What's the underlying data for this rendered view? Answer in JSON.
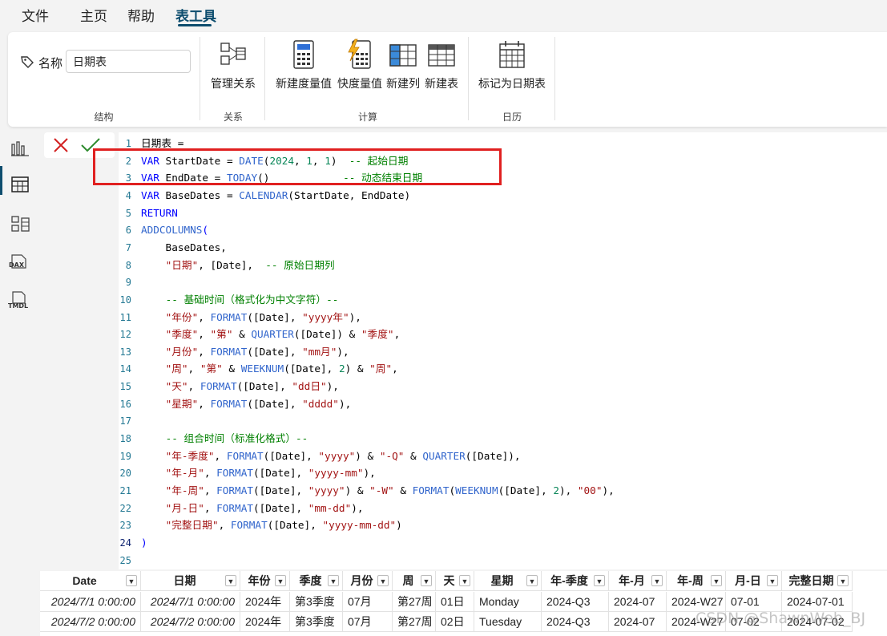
{
  "menu": {
    "tabs": [
      "文件",
      "主页",
      "帮助",
      "表工具"
    ],
    "active": "表工具"
  },
  "ribbon": {
    "name_label": "名称",
    "name_value": "日期表",
    "groups": {
      "structure": "结构",
      "relations": "关系",
      "calc": "计算",
      "calendar": "日历"
    },
    "buttons": {
      "manage_relations": "管理关系",
      "new_measure": "新建度量值",
      "quick_measure": "快度量值",
      "new_column": "新建列",
      "new_table": "新建表",
      "mark_date_table": "标记为日期表"
    }
  },
  "rail_icons": [
    "report-view-icon",
    "table-view-icon",
    "model-view-icon",
    "dax-query-icon",
    "tmdl-view-icon"
  ],
  "rail_labels": {
    "dax": "DAX",
    "tmdl": "TMDL"
  },
  "editor": {
    "lines": [
      [
        [
          "idx",
          "日期表 ="
        ]
      ],
      [
        [
          "kw",
          "VAR"
        ],
        [
          "idx",
          " StartDate = "
        ],
        [
          "fn",
          "DATE"
        ],
        [
          "idx",
          "("
        ],
        [
          "num",
          "2024"
        ],
        [
          "idx",
          ", "
        ],
        [
          "num",
          "1"
        ],
        [
          "idx",
          ", "
        ],
        [
          "num",
          "1"
        ],
        [
          "idx",
          ")  "
        ],
        [
          "cm",
          "-- 起始日期"
        ]
      ],
      [
        [
          "kw",
          "VAR"
        ],
        [
          "idx",
          " EndDate = "
        ],
        [
          "fn",
          "TODAY"
        ],
        [
          "idx",
          "()            "
        ],
        [
          "cm",
          "-- 动态结束日期"
        ]
      ],
      [
        [
          "kw",
          "VAR"
        ],
        [
          "idx",
          " BaseDates = "
        ],
        [
          "fn",
          "CALENDAR"
        ],
        [
          "idx",
          "(StartDate, EndDate)"
        ]
      ],
      [
        [
          "kw",
          "RETURN"
        ]
      ],
      [
        [
          "fn",
          "ADDCOLUMNS"
        ],
        [
          "kw",
          "("
        ]
      ],
      [
        [
          "idx",
          "    BaseDates,"
        ]
      ],
      [
        [
          "idx",
          "    "
        ],
        [
          "str",
          "\"日期\""
        ],
        [
          "idx",
          ", [Date],  "
        ],
        [
          "cm",
          "-- 原始日期列"
        ]
      ],
      [
        [
          "idx",
          ""
        ]
      ],
      [
        [
          "idx",
          "    "
        ],
        [
          "cm",
          "-- 基础时间（格式化为中文字符）--"
        ]
      ],
      [
        [
          "idx",
          "    "
        ],
        [
          "str",
          "\"年份\""
        ],
        [
          "idx",
          ", "
        ],
        [
          "fn",
          "FORMAT"
        ],
        [
          "idx",
          "([Date], "
        ],
        [
          "str",
          "\"yyyy年\""
        ],
        [
          "idx",
          "),"
        ]
      ],
      [
        [
          "idx",
          "    "
        ],
        [
          "str",
          "\"季度\""
        ],
        [
          "idx",
          ", "
        ],
        [
          "str",
          "\"第\""
        ],
        [
          "idx",
          " & "
        ],
        [
          "fn",
          "QUARTER"
        ],
        [
          "idx",
          "([Date]) & "
        ],
        [
          "str",
          "\"季度\""
        ],
        [
          "idx",
          ","
        ]
      ],
      [
        [
          "idx",
          "    "
        ],
        [
          "str",
          "\"月份\""
        ],
        [
          "idx",
          ", "
        ],
        [
          "fn",
          "FORMAT"
        ],
        [
          "idx",
          "([Date], "
        ],
        [
          "str",
          "\"mm月\""
        ],
        [
          "idx",
          "),"
        ]
      ],
      [
        [
          "idx",
          "    "
        ],
        [
          "str",
          "\"周\""
        ],
        [
          "idx",
          ", "
        ],
        [
          "str",
          "\"第\""
        ],
        [
          "idx",
          " & "
        ],
        [
          "fn",
          "WEEKNUM"
        ],
        [
          "idx",
          "([Date], "
        ],
        [
          "num",
          "2"
        ],
        [
          "idx",
          ") & "
        ],
        [
          "str",
          "\"周\""
        ],
        [
          "idx",
          ","
        ]
      ],
      [
        [
          "idx",
          "    "
        ],
        [
          "str",
          "\"天\""
        ],
        [
          "idx",
          ", "
        ],
        [
          "fn",
          "FORMAT"
        ],
        [
          "idx",
          "([Date], "
        ],
        [
          "str",
          "\"dd日\""
        ],
        [
          "idx",
          "),"
        ]
      ],
      [
        [
          "idx",
          "    "
        ],
        [
          "str",
          "\"星期\""
        ],
        [
          "idx",
          ", "
        ],
        [
          "fn",
          "FORMAT"
        ],
        [
          "idx",
          "([Date], "
        ],
        [
          "str",
          "\"dddd\""
        ],
        [
          "idx",
          "),"
        ]
      ],
      [
        [
          "idx",
          ""
        ]
      ],
      [
        [
          "idx",
          "    "
        ],
        [
          "cm",
          "-- 组合时间（标准化格式）--"
        ]
      ],
      [
        [
          "idx",
          "    "
        ],
        [
          "str",
          "\"年-季度\""
        ],
        [
          "idx",
          ", "
        ],
        [
          "fn",
          "FORMAT"
        ],
        [
          "idx",
          "([Date], "
        ],
        [
          "str",
          "\"yyyy\""
        ],
        [
          "idx",
          ") & "
        ],
        [
          "str",
          "\"-Q\""
        ],
        [
          "idx",
          " & "
        ],
        [
          "fn",
          "QUARTER"
        ],
        [
          "idx",
          "([Date]),"
        ]
      ],
      [
        [
          "idx",
          "    "
        ],
        [
          "str",
          "\"年-月\""
        ],
        [
          "idx",
          ", "
        ],
        [
          "fn",
          "FORMAT"
        ],
        [
          "idx",
          "([Date], "
        ],
        [
          "str",
          "\"yyyy-mm\""
        ],
        [
          "idx",
          "),"
        ]
      ],
      [
        [
          "idx",
          "    "
        ],
        [
          "str",
          "\"年-周\""
        ],
        [
          "idx",
          ", "
        ],
        [
          "fn",
          "FORMAT"
        ],
        [
          "idx",
          "([Date], "
        ],
        [
          "str",
          "\"yyyy\""
        ],
        [
          "idx",
          ") & "
        ],
        [
          "str",
          "\"-W\""
        ],
        [
          "idx",
          " & "
        ],
        [
          "fn",
          "FORMAT"
        ],
        [
          "idx",
          "("
        ],
        [
          "fn",
          "WEEKNUM"
        ],
        [
          "idx",
          "([Date], "
        ],
        [
          "num",
          "2"
        ],
        [
          "idx",
          "), "
        ],
        [
          "str",
          "\"00\""
        ],
        [
          "idx",
          "),"
        ]
      ],
      [
        [
          "idx",
          "    "
        ],
        [
          "str",
          "\"月-日\""
        ],
        [
          "idx",
          ", "
        ],
        [
          "fn",
          "FORMAT"
        ],
        [
          "idx",
          "([Date], "
        ],
        [
          "str",
          "\"mm-dd\""
        ],
        [
          "idx",
          "),"
        ]
      ],
      [
        [
          "idx",
          "    "
        ],
        [
          "str",
          "\"完整日期\""
        ],
        [
          "idx",
          ", "
        ],
        [
          "fn",
          "FORMAT"
        ],
        [
          "idx",
          "([Date], "
        ],
        [
          "str",
          "\"yyyy-mm-dd\""
        ],
        [
          "idx",
          ")"
        ]
      ],
      [
        [
          "kw",
          ")"
        ]
      ],
      [
        [
          "idx",
          ""
        ]
      ]
    ]
  },
  "grid": {
    "columns": [
      "Date",
      "日期",
      "年份",
      "季度",
      "月份",
      "周",
      "天",
      "星期",
      "年-季度",
      "年-月",
      "年-周",
      "月-日",
      "完整日期"
    ],
    "rows": [
      [
        "2024/7/1 0:00:00",
        "2024/7/1 0:00:00",
        "2024年",
        "第3季度",
        "07月",
        "第27周",
        "01日",
        "Monday",
        "2024-Q3",
        "2024-07",
        "2024-W27",
        "07-01",
        "2024-07-01"
      ],
      [
        "2024/7/2 0:00:00",
        "2024/7/2 0:00:00",
        "2024年",
        "第3季度",
        "07月",
        "第27周",
        "02日",
        "Tuesday",
        "2024-Q3",
        "2024-07",
        "2024-W27",
        "07-02",
        "2024-07-02"
      ]
    ]
  },
  "watermark": "CSDN @ShawnWeb_BJ",
  "colors": {
    "accent": "#0e4d6e",
    "highlight_box": "#e02020",
    "confirm_check": "#2e8b2e",
    "cancel_x": "#d22020"
  }
}
